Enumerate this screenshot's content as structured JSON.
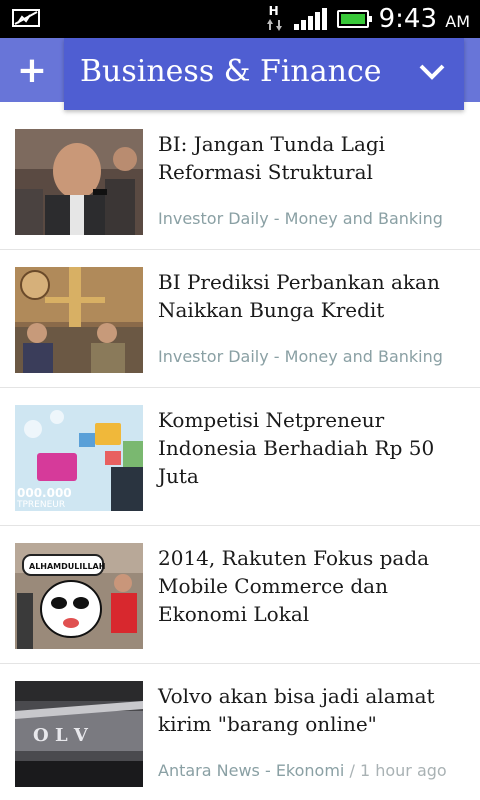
{
  "status_bar": {
    "network_type": "H",
    "time": "9:43",
    "ampm": "AM",
    "icons": [
      "notification-icon",
      "data-arrows-icon",
      "signal-icon",
      "battery-icon"
    ]
  },
  "header": {
    "add_label": "+",
    "section_title": "Business & Finance",
    "accent_color": "#6875d8",
    "selector_color": "#4f5ed2"
  },
  "articles": [
    {
      "title": "BI: Jangan Tunda Lagi Reformasi Struktural",
      "source": "Investor Daily - Money and Banking",
      "time": ""
    },
    {
      "title": "BI Prediksi Perbankan akan Naikkan Bunga Kredit",
      "source": "Investor Daily - Money and Banking",
      "time": ""
    },
    {
      "title": "Kompetisi Netpreneur Indonesia Berhadiah Rp 50 Juta",
      "source": "",
      "time": ""
    },
    {
      "title": "2014, Rakuten Fokus pada Mobile Commerce dan Ekonomi Lokal",
      "source": "",
      "time": ""
    },
    {
      "title": "Volvo akan bisa jadi alamat kirim \"barang online\"",
      "source": "Antara News - Ekonomi",
      "time": " / 1 hour ago"
    }
  ],
  "thumbnail_text": {
    "netpreneur": "000.000",
    "netpreneur2": "TPRENEUR",
    "rakuten_bubble": "ALHAMDULILLAH",
    "volvo_letters": "O L V"
  }
}
